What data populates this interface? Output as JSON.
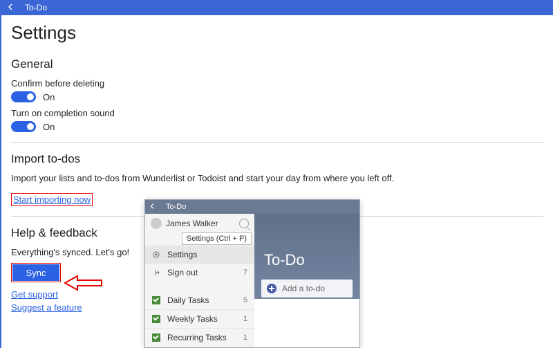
{
  "titlebar": {
    "app_name": "To-Do"
  },
  "page": {
    "title": "Settings"
  },
  "general": {
    "heading": "General",
    "confirm_delete": {
      "label": "Confirm before deleting",
      "state": "On"
    },
    "completion_sound": {
      "label": "Turn on completion sound",
      "state": "On"
    }
  },
  "import": {
    "heading": "Import to-dos",
    "desc": "Import your lists and to-dos from Wunderlist or Todoist and start your day from where you left off.",
    "link": "Start importing now"
  },
  "help": {
    "heading": "Help & feedback",
    "status": "Everything's synced. Let's go!",
    "sync_label": "Sync",
    "get_support": "Get support",
    "suggest_feature": "Suggest a feature"
  },
  "overlay": {
    "app_name": "To-Do",
    "user": "James Walker",
    "tooltip": "Settings (Ctrl + P)",
    "menu_settings": "Settings",
    "menu_signout": "Sign out",
    "main_title": "To-Do",
    "add_placeholder": "Add a to-do",
    "lists": [
      {
        "name": "Daily Tasks",
        "count": "5"
      },
      {
        "name": "Weekly Tasks",
        "count": "1"
      },
      {
        "name": "Recurring Tasks",
        "count": "1"
      }
    ],
    "sidebar_count": "7"
  }
}
